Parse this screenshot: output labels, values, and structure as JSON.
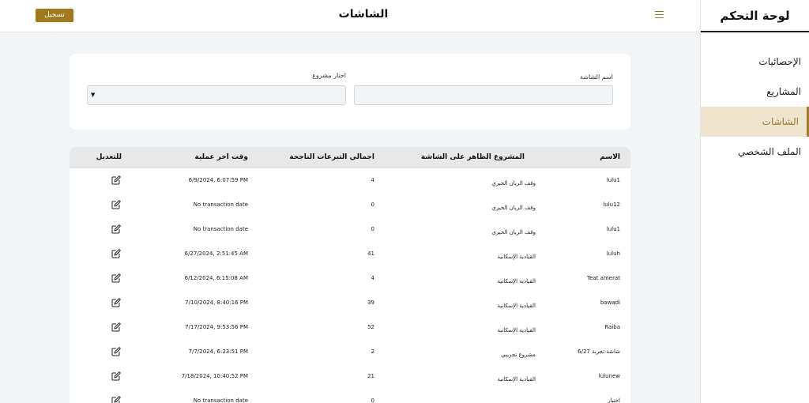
{
  "sidebar": {
    "title": "لوحة التحكم",
    "items": [
      {
        "label": "الإحصائيات",
        "active": false
      },
      {
        "label": "المشاريع",
        "active": false
      },
      {
        "label": "الشاشات",
        "active": true
      },
      {
        "label": "الملف الشخصي",
        "active": false
      }
    ]
  },
  "topbar": {
    "title": "الشاشات",
    "logout_label": "تسجيل خروج",
    "menu_icon": "hamburger-menu-icon"
  },
  "filters": {
    "screen_name_label": "اسم الشاشة",
    "screen_name_value": "",
    "project_label": "اختار مشروع",
    "project_value": ""
  },
  "table": {
    "headers": {
      "name": "الاسم",
      "project": "المشروع الظاهر على الشاشة",
      "total": "اجمالي التبرعات الناجحة",
      "last_time": "وقت اخر عملية",
      "edit": "للتعديل"
    },
    "rows": [
      {
        "name": "lulu1",
        "project": "وقف الريان الخيري",
        "total": "4",
        "last_time": "6/9/2024, 6:07:59 PM"
      },
      {
        "name": "lulu12",
        "project": "وقف الريان الخيري",
        "total": "0",
        "last_time": "No transaction date"
      },
      {
        "name": "lulu1",
        "project": "وقف الريان الخيري",
        "total": "0",
        "last_time": "No transaction date"
      },
      {
        "name": "luluh",
        "project": "القيادية الإسكانية",
        "total": "41",
        "last_time": "6/27/2024, 2:51:45 AM"
      },
      {
        "name": "Teat amerat",
        "project": "القيادية الإسكانية",
        "total": "4",
        "last_time": "6/12/2024, 6:15:08 AM"
      },
      {
        "name": "bawadi",
        "project": "القيادية الإسكانية",
        "total": "39",
        "last_time": "7/10/2024, 8:40:16 PM"
      },
      {
        "name": "Raiba",
        "project": "القيادية الإسكانية",
        "total": "52",
        "last_time": "7/17/2024, 9:53:56 PM"
      },
      {
        "name": "شاشة تجربة 6/27",
        "project": "مشروع تجريبي",
        "total": "2",
        "last_time": "7/7/2024, 6:23:51 PM"
      },
      {
        "name": "lulunew",
        "project": "القيادية الإسكانية",
        "total": "21",
        "last_time": "7/18/2024, 10:40:52 PM"
      },
      {
        "name": "اختبار",
        "project": "",
        "total": "0",
        "last_time": "No transaction date"
      }
    ]
  },
  "colors": {
    "accent": "#a07a1e",
    "active_bg": "#efe4cd",
    "page_bg": "#f3f4f6"
  }
}
